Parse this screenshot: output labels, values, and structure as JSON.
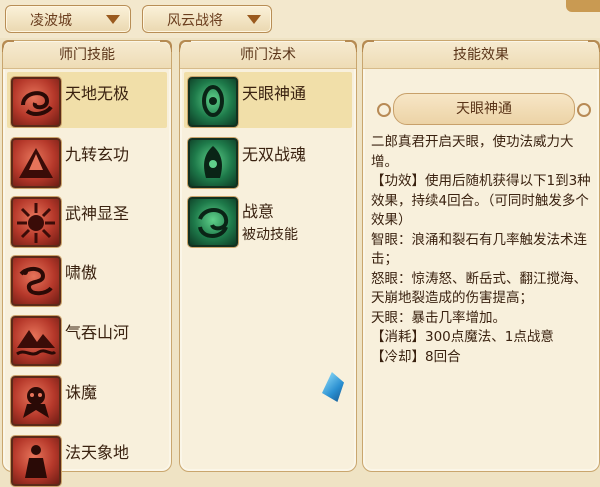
{
  "dropdowns": [
    {
      "label": "凌波城"
    },
    {
      "label": "风云战将"
    }
  ],
  "panels": {
    "school_skills": {
      "title": "师门技能",
      "items": [
        {
          "label": "天地无极",
          "icon": "swirl-red-icon"
        },
        {
          "label": "九转玄功",
          "icon": "mountain-red-icon"
        },
        {
          "label": "武神显圣",
          "icon": "burst-red-icon"
        },
        {
          "label": "啸傲",
          "icon": "dragon-red-icon"
        },
        {
          "label": "气吞山河",
          "icon": "wave-mountain-red-icon"
        },
        {
          "label": "诛魔",
          "icon": "demon-red-icon"
        },
        {
          "label": "法天象地",
          "icon": "figure-red-icon"
        }
      ]
    },
    "school_spells": {
      "title": "师门法术",
      "items": [
        {
          "label": "天眼神通",
          "sub": "",
          "icon": "eye-green-icon"
        },
        {
          "label": "无双战魂",
          "sub": "",
          "icon": "spirit-green-icon"
        },
        {
          "label": "战意",
          "sub": "被动技能",
          "icon": "vortex-green-icon"
        }
      ]
    },
    "skill_effect": {
      "title": "技能效果",
      "skill_name": "天眼神通",
      "lines": [
        "二郎真君开启天眼，使功法威力大增。",
        "【功效】使用后随机获得以下1到3种效果，持续4回合。（可同时触发多个效果）",
        "智眼：浪涌和裂石有几率触发法术连击；",
        "怒眼：惊涛怒、断岳式、翻江搅海、天崩地裂造成的伤害提高；",
        "天眼：暴击几率增加。",
        "【消耗】300点魔法、1点战意",
        "【冷却】8回合"
      ]
    }
  },
  "colors": {
    "panel_bg": "#f8f0dc",
    "selected_row": "#f1dfa9",
    "border": "#c9a66e",
    "text": "#3a2210"
  }
}
